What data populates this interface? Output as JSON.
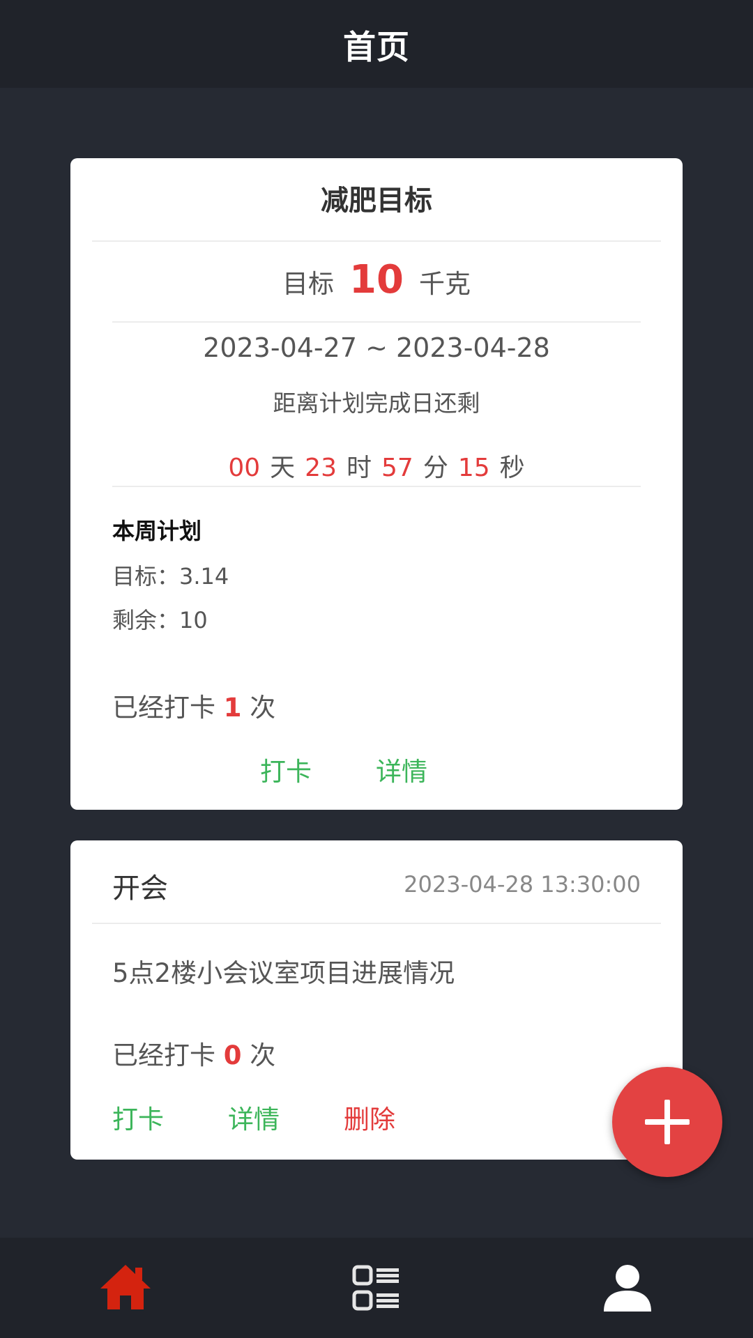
{
  "header": {
    "title": "首页"
  },
  "goal_card": {
    "title": "减肥目标",
    "goal_prefix": "目标",
    "goal_value": "10",
    "goal_unit": "千克",
    "date_range": "2023-04-27 ~ 2023-04-28",
    "remain_label": "距离计划完成日还剩",
    "countdown": {
      "days": "00",
      "days_unit": "天",
      "hours": "23",
      "hours_unit": "时",
      "minutes": "57",
      "minutes_unit": "分",
      "seconds": "15",
      "seconds_unit": "秒"
    },
    "week_plan_title": "本周计划",
    "week_target": "目标：3.14",
    "week_remain": "剩余：10",
    "checkin_prefix": "已经打卡",
    "checkin_count": "1",
    "checkin_suffix": "次",
    "checkin_button": "打卡",
    "detail_button": "详情"
  },
  "meeting_card": {
    "title": "开会",
    "time": "2023-04-28 13:30:00",
    "description": "5点2楼小会议室项目进展情况",
    "checkin_prefix": "已经打卡",
    "checkin_count": "0",
    "checkin_suffix": "次",
    "checkin_button": "打卡",
    "detail_button": "详情",
    "delete_button": "删除"
  },
  "fab": {
    "icon": "plus-icon"
  },
  "tabbar": {
    "items": [
      {
        "icon": "home-icon",
        "active": true
      },
      {
        "icon": "list-icon",
        "active": false
      },
      {
        "icon": "user-icon",
        "active": false
      }
    ]
  },
  "colors": {
    "accent_red": "#e33b3b",
    "action_green": "#3cb55a",
    "background": "#262a33",
    "bar": "#20232a",
    "active_tab": "#d4230f"
  }
}
